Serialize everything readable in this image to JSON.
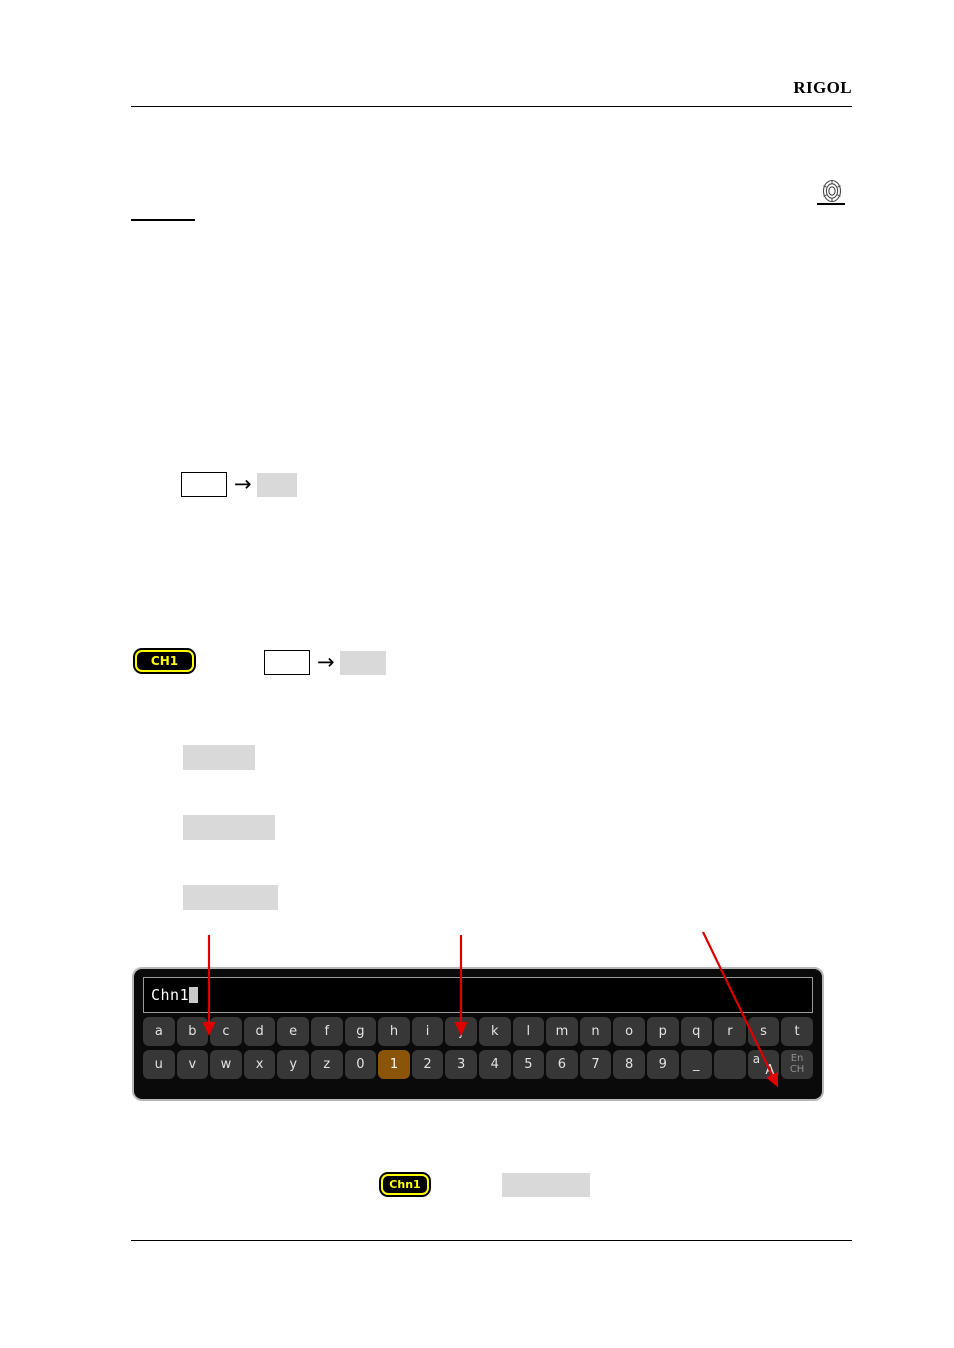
{
  "header": {
    "brand": "RIGOL"
  },
  "icons": {
    "multifunction_knob": "knob-icon"
  },
  "badges": {
    "ch1": "CH1",
    "chn1": "Chn1"
  },
  "flow_steps": {
    "arrow_glyph": "→"
  },
  "keyboard": {
    "display_value": "Chn1",
    "row1": [
      {
        "label": "a",
        "selected": false
      },
      {
        "label": "b",
        "selected": false
      },
      {
        "label": "c",
        "selected": false
      },
      {
        "label": "d",
        "selected": false
      },
      {
        "label": "e",
        "selected": false
      },
      {
        "label": "f",
        "selected": false
      },
      {
        "label": "g",
        "selected": false
      },
      {
        "label": "h",
        "selected": false
      },
      {
        "label": "i",
        "selected": false
      },
      {
        "label": "j",
        "selected": false
      },
      {
        "label": "k",
        "selected": false
      },
      {
        "label": "l",
        "selected": false
      },
      {
        "label": "m",
        "selected": false
      },
      {
        "label": "n",
        "selected": false
      },
      {
        "label": "o",
        "selected": false
      },
      {
        "label": "p",
        "selected": false
      },
      {
        "label": "q",
        "selected": false
      },
      {
        "label": "r",
        "selected": false
      },
      {
        "label": "s",
        "selected": false
      },
      {
        "label": "t",
        "selected": false
      }
    ],
    "row2": [
      {
        "label": "u",
        "selected": false
      },
      {
        "label": "v",
        "selected": false
      },
      {
        "label": "w",
        "selected": false
      },
      {
        "label": "x",
        "selected": false
      },
      {
        "label": "y",
        "selected": false
      },
      {
        "label": "z",
        "selected": false
      },
      {
        "label": "0",
        "selected": false
      },
      {
        "label": "1",
        "selected": true
      },
      {
        "label": "2",
        "selected": false
      },
      {
        "label": "3",
        "selected": false
      },
      {
        "label": "4",
        "selected": false
      },
      {
        "label": "5",
        "selected": false
      },
      {
        "label": "6",
        "selected": false
      },
      {
        "label": "7",
        "selected": false
      },
      {
        "label": "8",
        "selected": false
      },
      {
        "label": "9",
        "selected": false
      },
      {
        "label": "_",
        "selected": false
      },
      {
        "label": "",
        "selected": false
      },
      {
        "label": "aA",
        "selected": false
      },
      {
        "label": "EnCH",
        "selected": false
      }
    ],
    "case_key": {
      "lower": "a",
      "upper": "A"
    },
    "lang_key": {
      "top": "En",
      "bottom": "CH"
    }
  },
  "colors": {
    "badge_border": "#ffff00",
    "badge_text": "#ffff00",
    "badge_bg": "#000000",
    "key_bg": "#373737",
    "key_selected_bg": "#8a5508",
    "panel_border": "#b8b8b8",
    "placeholder": "#d9d9d9",
    "callout": "#e00000"
  }
}
